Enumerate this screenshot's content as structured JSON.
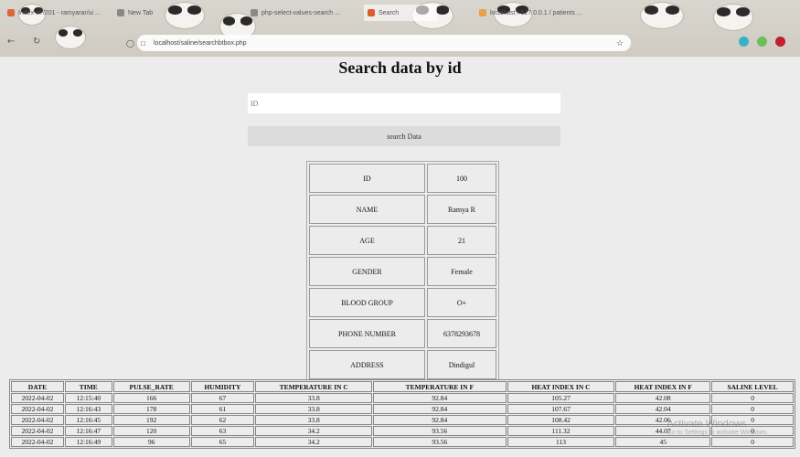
{
  "browser": {
    "tabs": [
      {
        "label": "Index of /201 - ramyarar/ui ...",
        "color": "#d9673b"
      },
      {
        "label": "New Tab",
        "color": "#888888"
      },
      {
        "label": "php-select-values-search ...",
        "color": "#888888"
      },
      {
        "label": "Search",
        "color": "#e05a2b"
      },
      {
        "label": "localhost / 127.0.0.1 / patients ...",
        "color": "#e8a04a"
      }
    ],
    "url": "localhost/saline/searchbtbox.php",
    "back_icon": "back-arrow-icon",
    "reload_icon": "reload-icon",
    "star_icon": "star-icon"
  },
  "page": {
    "title": "Search data by id",
    "id_placeholder": "ID",
    "search_button": "search Data"
  },
  "details": [
    {
      "key": "ID",
      "value": "100"
    },
    {
      "key": "NAME",
      "value": "Ramya R"
    },
    {
      "key": "AGE",
      "value": "21"
    },
    {
      "key": "GENDER",
      "value": "Female"
    },
    {
      "key": "BLOOD GROUP",
      "value": "O+"
    },
    {
      "key": "PHONE NUMBER",
      "value": "6378293678"
    },
    {
      "key": "ADDRESS",
      "value": "Dindigul"
    }
  ],
  "readings": {
    "headers": [
      "DATE",
      "TIME",
      "PULSE_RATE",
      "HUMIDITY",
      "TEMPERATURE IN C",
      "TEMPERATURE IN F",
      "HEAT INDEX IN C",
      "HEAT INDEX IN F",
      "SALINE LEVEL"
    ],
    "rows": [
      [
        "2022-04-02",
        "12:15:40",
        "166",
        "67",
        "33.8",
        "92.84",
        "105.27",
        "42.08",
        "0"
      ],
      [
        "2022-04-02",
        "12:16:43",
        "178",
        "61",
        "33.8",
        "92.84",
        "107.67",
        "42.04",
        "0"
      ],
      [
        "2022-04-02",
        "12:16:45",
        "192",
        "62",
        "33.8",
        "92.84",
        "108.42",
        "42.06",
        "0"
      ],
      [
        "2022-04-02",
        "12:16:47",
        "120",
        "63",
        "34.2",
        "93.56",
        "111.32",
        "44.07",
        "0"
      ],
      [
        "2022-04-02",
        "12:16:49",
        "96",
        "65",
        "34.2",
        "93.56",
        "113",
        "45",
        "0"
      ]
    ]
  },
  "watermark": {
    "line1": "Activate Windows",
    "line2": "Go to Settings to activate Windows."
  }
}
